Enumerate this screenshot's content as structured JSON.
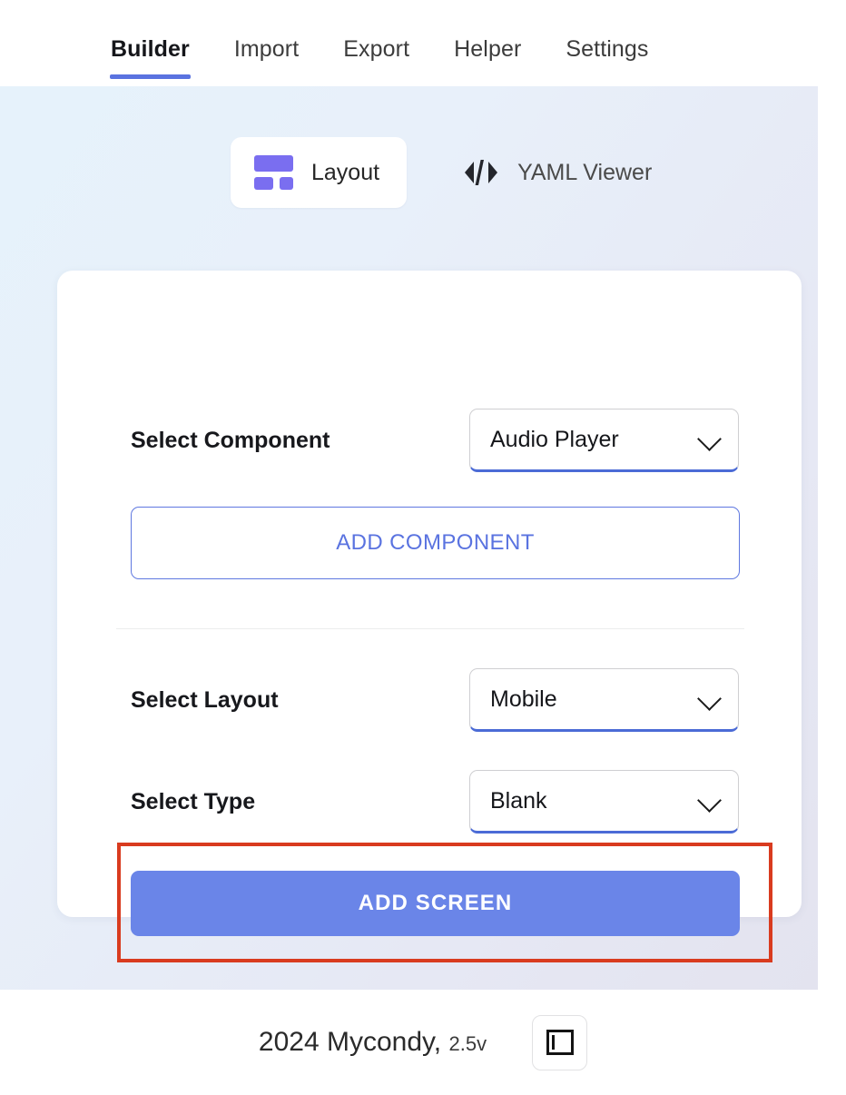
{
  "nav": {
    "tabs": [
      {
        "label": "Builder",
        "active": true
      },
      {
        "label": "Import",
        "active": false
      },
      {
        "label": "Export",
        "active": false
      },
      {
        "label": "Helper",
        "active": false
      },
      {
        "label": "Settings",
        "active": false
      }
    ]
  },
  "view_toggle": {
    "layout": {
      "label": "Layout",
      "icon": "layout-icon",
      "selected": true
    },
    "yaml": {
      "label": "YAML Viewer",
      "icon": "code-icon",
      "selected": false
    }
  },
  "form": {
    "component": {
      "label": "Select Component",
      "value": "Audio Player"
    },
    "add_component_button": "ADD COMPONENT",
    "layout": {
      "label": "Select Layout",
      "value": "Mobile"
    },
    "type": {
      "label": "Select Type",
      "value": "Blank"
    },
    "add_screen_button": "ADD SCREEN"
  },
  "footer": {
    "copyright": "2024 Mycondy,",
    "version": "2.5v",
    "sidebar_toggle_icon": "panel-left-icon"
  },
  "colors": {
    "accent_blue": "#5a73e0",
    "primary_button": "#6a85e8",
    "icon_purple": "#7a6ef0",
    "annotation_red": "#d93b1f",
    "select_underline": "#4b6bd6",
    "bg_gradient_start": "#e6f2fb",
    "bg_gradient_end": "#e3e3ef"
  }
}
